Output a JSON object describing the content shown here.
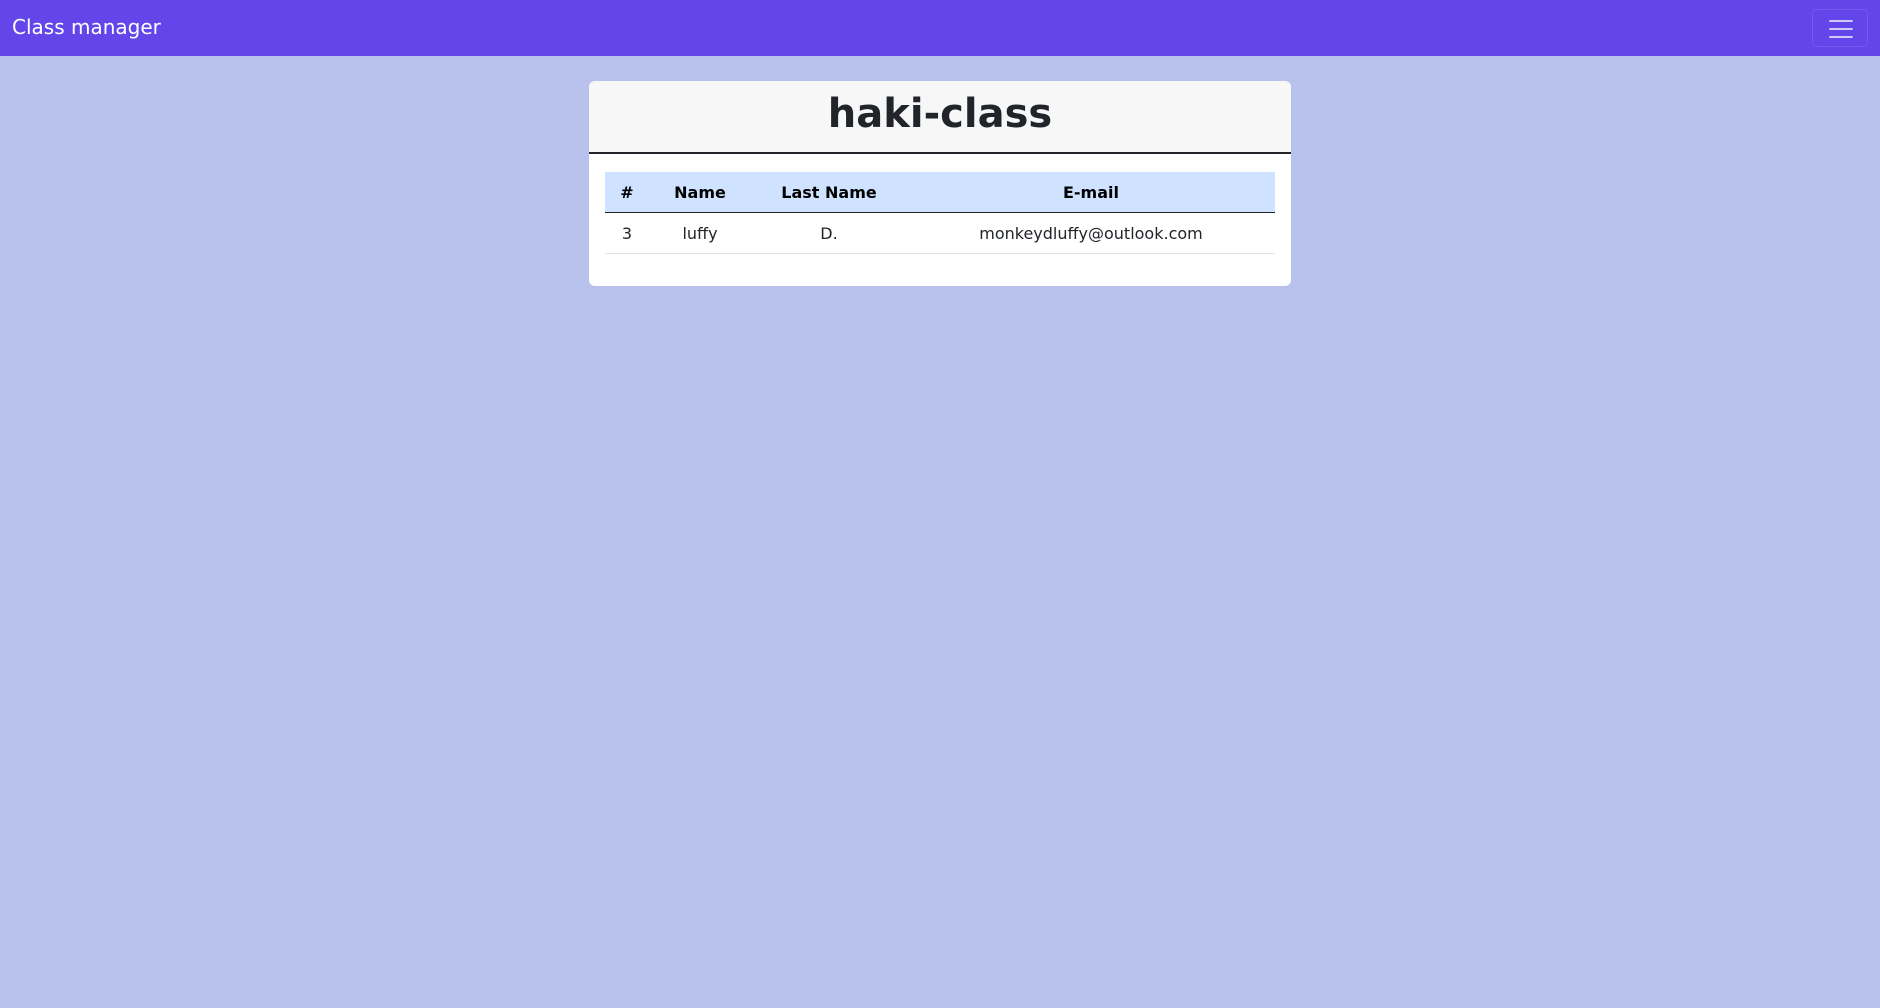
{
  "navbar": {
    "brand": "Class manager",
    "toggler_icon": "hamburger-menu-icon"
  },
  "class_card": {
    "title": "haki-class",
    "table": {
      "headers": [
        "#",
        "Name",
        "Last Name",
        "E-mail"
      ],
      "rows": [
        {
          "number": "3",
          "name": "luffy",
          "last_name": "D.",
          "email": "monkeydluffy@outlook.com"
        }
      ]
    }
  },
  "colors": {
    "navbar": "#6246ea",
    "background": "#b8c1ec",
    "table_header": "#cfe2ff"
  }
}
